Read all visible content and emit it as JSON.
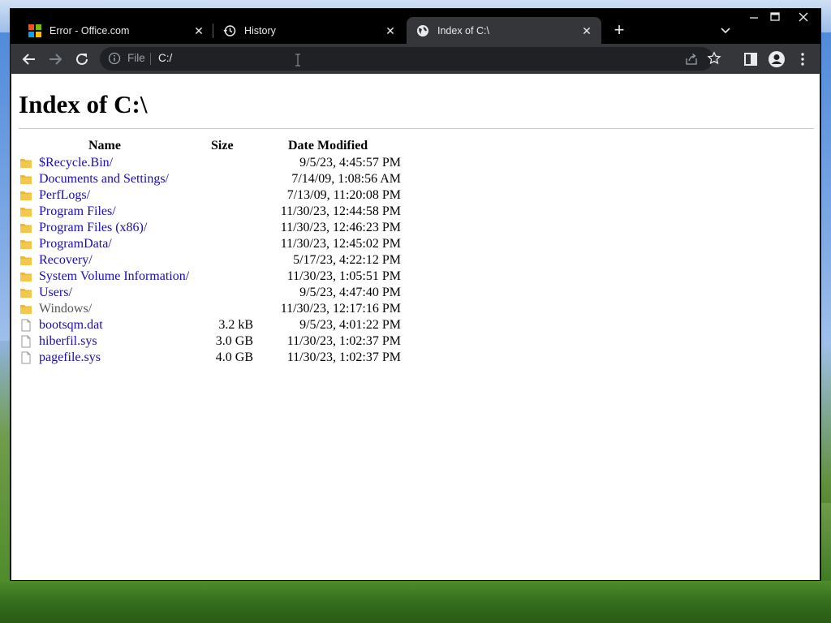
{
  "browser": {
    "tabs": [
      {
        "title": "Error - Office.com",
        "icon": "microsoft-logo-icon",
        "active": false
      },
      {
        "title": "History",
        "icon": "history-icon",
        "active": false
      },
      {
        "title": "Index of C:\\",
        "icon": "globe-icon",
        "active": true
      }
    ],
    "new_tab_label": "+",
    "close_glyph": "✕",
    "omnibox": {
      "security_label": "File",
      "url": "C:/"
    }
  },
  "page": {
    "title": "Index of C:\\",
    "columns": {
      "name": "Name",
      "size": "Size",
      "date": "Date Modified"
    },
    "rows": [
      {
        "name": "$Recycle.Bin/",
        "size": "",
        "date": "9/5/23, 4:45:57 PM",
        "type": "folder",
        "visited": false
      },
      {
        "name": "Documents and Settings/",
        "size": "",
        "date": "7/14/09, 1:08:56 AM",
        "type": "folder",
        "visited": false
      },
      {
        "name": "PerfLogs/",
        "size": "",
        "date": "7/13/09, 11:20:08 PM",
        "type": "folder",
        "visited": false
      },
      {
        "name": "Program Files/",
        "size": "",
        "date": "11/30/23, 12:44:58 PM",
        "type": "folder",
        "visited": false
      },
      {
        "name": "Program Files (x86)/",
        "size": "",
        "date": "11/30/23, 12:46:23 PM",
        "type": "folder",
        "visited": false
      },
      {
        "name": "ProgramData/",
        "size": "",
        "date": "11/30/23, 12:45:02 PM",
        "type": "folder",
        "visited": false
      },
      {
        "name": "Recovery/",
        "size": "",
        "date": "5/17/23, 4:22:12 PM",
        "type": "folder",
        "visited": false
      },
      {
        "name": "System Volume Information/",
        "size": "",
        "date": "11/30/23, 1:05:51 PM",
        "type": "folder",
        "visited": false
      },
      {
        "name": "Users/",
        "size": "",
        "date": "9/5/23, 4:47:40 PM",
        "type": "folder",
        "visited": false
      },
      {
        "name": "Windows/",
        "size": "",
        "date": "11/30/23, 12:17:16 PM",
        "type": "folder",
        "visited": true
      },
      {
        "name": "bootsqm.dat",
        "size": "3.2 kB",
        "date": "9/5/23, 4:01:22 PM",
        "type": "file",
        "visited": false
      },
      {
        "name": "hiberfil.sys",
        "size": "3.0 GB",
        "date": "11/30/23, 1:02:37 PM",
        "type": "file",
        "visited": false
      },
      {
        "name": "pagefile.sys",
        "size": "4.0 GB",
        "date": "11/30/23, 1:02:37 PM",
        "type": "file",
        "visited": false
      }
    ]
  },
  "colors": {
    "link": "#1a0dab",
    "visited": "#555555",
    "folder": "#f4c84c",
    "tab_bg": "#000000",
    "toolbar_bg": "#35363a"
  }
}
